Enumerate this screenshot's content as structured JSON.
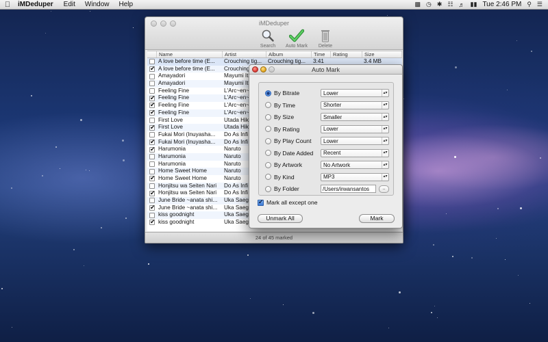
{
  "menubar": {
    "app_name": "iMDeduper",
    "items": [
      "Edit",
      "Window",
      "Help"
    ],
    "clock": "Tue 2:46 PM"
  },
  "main_window": {
    "title": "iMDeduper",
    "toolbar": {
      "search_label": "Search",
      "automark_label": "Auto Mark",
      "delete_label": "Delete"
    },
    "columns": [
      "Name",
      "Artist",
      "Album",
      "Time",
      "Rating",
      "Size"
    ],
    "rows": [
      {
        "checked": false,
        "name": "A love before time (E...",
        "artist": "Crouching tig...",
        "album": "Crouching tig...",
        "time": "3:41",
        "rating": "",
        "size": "3.4 MB"
      },
      {
        "checked": true,
        "name": "A love before time (E...",
        "artist": "Crouching",
        "album": "",
        "time": "",
        "rating": "",
        "size": ""
      },
      {
        "checked": false,
        "name": "Amayadori",
        "artist": "Mayumi It",
        "album": "",
        "time": "",
        "rating": "",
        "size": ""
      },
      {
        "checked": false,
        "name": "Amayadori",
        "artist": "Mayumi It",
        "album": "",
        "time": "",
        "rating": "",
        "size": ""
      },
      {
        "checked": false,
        "name": "Feeling Fine",
        "artist": "L'Arc~en~",
        "album": "",
        "time": "",
        "rating": "",
        "size": ""
      },
      {
        "checked": true,
        "name": "Feeling Fine",
        "artist": "L'Arc~en~",
        "album": "",
        "time": "",
        "rating": "",
        "size": ""
      },
      {
        "checked": true,
        "name": "Feeling Fine",
        "artist": "L'Arc~en~",
        "album": "",
        "time": "",
        "rating": "",
        "size": ""
      },
      {
        "checked": true,
        "name": "Feeling Fine",
        "artist": "L'Arc~en~",
        "album": "",
        "time": "",
        "rating": "",
        "size": ""
      },
      {
        "checked": false,
        "name": "First Love",
        "artist": "Utada Hik",
        "album": "",
        "time": "",
        "rating": "",
        "size": ""
      },
      {
        "checked": true,
        "name": "First Love",
        "artist": "Utada Hik",
        "album": "",
        "time": "",
        "rating": "",
        "size": ""
      },
      {
        "checked": false,
        "name": "Fukai Mori (Inuyasha...",
        "artist": "Do As Infi",
        "album": "",
        "time": "",
        "rating": "",
        "size": ""
      },
      {
        "checked": true,
        "name": "Fukai Mori (Inuyasha...",
        "artist": "Do As Infi",
        "album": "",
        "time": "",
        "rating": "",
        "size": ""
      },
      {
        "checked": true,
        "name": "Harumonia",
        "artist": "Naruto",
        "album": "",
        "time": "",
        "rating": "",
        "size": ""
      },
      {
        "checked": false,
        "name": "Harumonia",
        "artist": "Naruto",
        "album": "",
        "time": "",
        "rating": "",
        "size": ""
      },
      {
        "checked": false,
        "name": "Harumonia",
        "artist": "Naruto",
        "album": "",
        "time": "",
        "rating": "",
        "size": ""
      },
      {
        "checked": false,
        "name": "Home Sweet Home",
        "artist": "Naruto",
        "album": "",
        "time": "",
        "rating": "",
        "size": ""
      },
      {
        "checked": true,
        "name": "Home Sweet Home",
        "artist": "Naruto",
        "album": "",
        "time": "",
        "rating": "",
        "size": ""
      },
      {
        "checked": false,
        "name": "Honjitsu wa Seiten Nari",
        "artist": "Do As Infi",
        "album": "",
        "time": "",
        "rating": "",
        "size": ""
      },
      {
        "checked": true,
        "name": "Honjitsu wa Seiten Nari",
        "artist": "Do As Infi",
        "album": "",
        "time": "",
        "rating": "",
        "size": ""
      },
      {
        "checked": false,
        "name": "June Bride ~anata shi...",
        "artist": "Uka Saegu",
        "album": "",
        "time": "",
        "rating": "",
        "size": ""
      },
      {
        "checked": true,
        "name": "June Bride ~anata shi...",
        "artist": "Uka Saegu",
        "album": "",
        "time": "",
        "rating": "",
        "size": ""
      },
      {
        "checked": false,
        "name": "kiss goodnight",
        "artist": "Uka Saegu",
        "album": "",
        "time": "",
        "rating": "",
        "size": ""
      },
      {
        "checked": true,
        "name": "kiss goodnight",
        "artist": "Uka Saegu",
        "album": "",
        "time": "",
        "rating": "",
        "size": ""
      }
    ],
    "status": "24 of 45 marked"
  },
  "auto_mark": {
    "title": "Auto Mark",
    "options": [
      {
        "label": "By Bitrate",
        "selected": true,
        "value": "Lower"
      },
      {
        "label": "By Time",
        "selected": false,
        "value": "Shorter"
      },
      {
        "label": "By Size",
        "selected": false,
        "value": "Smaller"
      },
      {
        "label": "By Rating",
        "selected": false,
        "value": "Lower"
      },
      {
        "label": "By Play Count",
        "selected": false,
        "value": "Lower"
      },
      {
        "label": "By Date Added",
        "selected": false,
        "value": "Recent"
      },
      {
        "label": "By Artwork",
        "selected": false,
        "value": "No Artwork"
      },
      {
        "label": "By Kind",
        "selected": false,
        "value": "MP3"
      },
      {
        "label": "By Folder",
        "selected": false,
        "value": "/Users/irwansantos"
      }
    ],
    "browse_label": "..",
    "except_label": "Mark all except one",
    "except_checked": true,
    "unmark_all_label": "Unmark All",
    "mark_label": "Mark"
  },
  "colors": {
    "accent": "#3b78d8",
    "check_green": "#39b54a"
  }
}
